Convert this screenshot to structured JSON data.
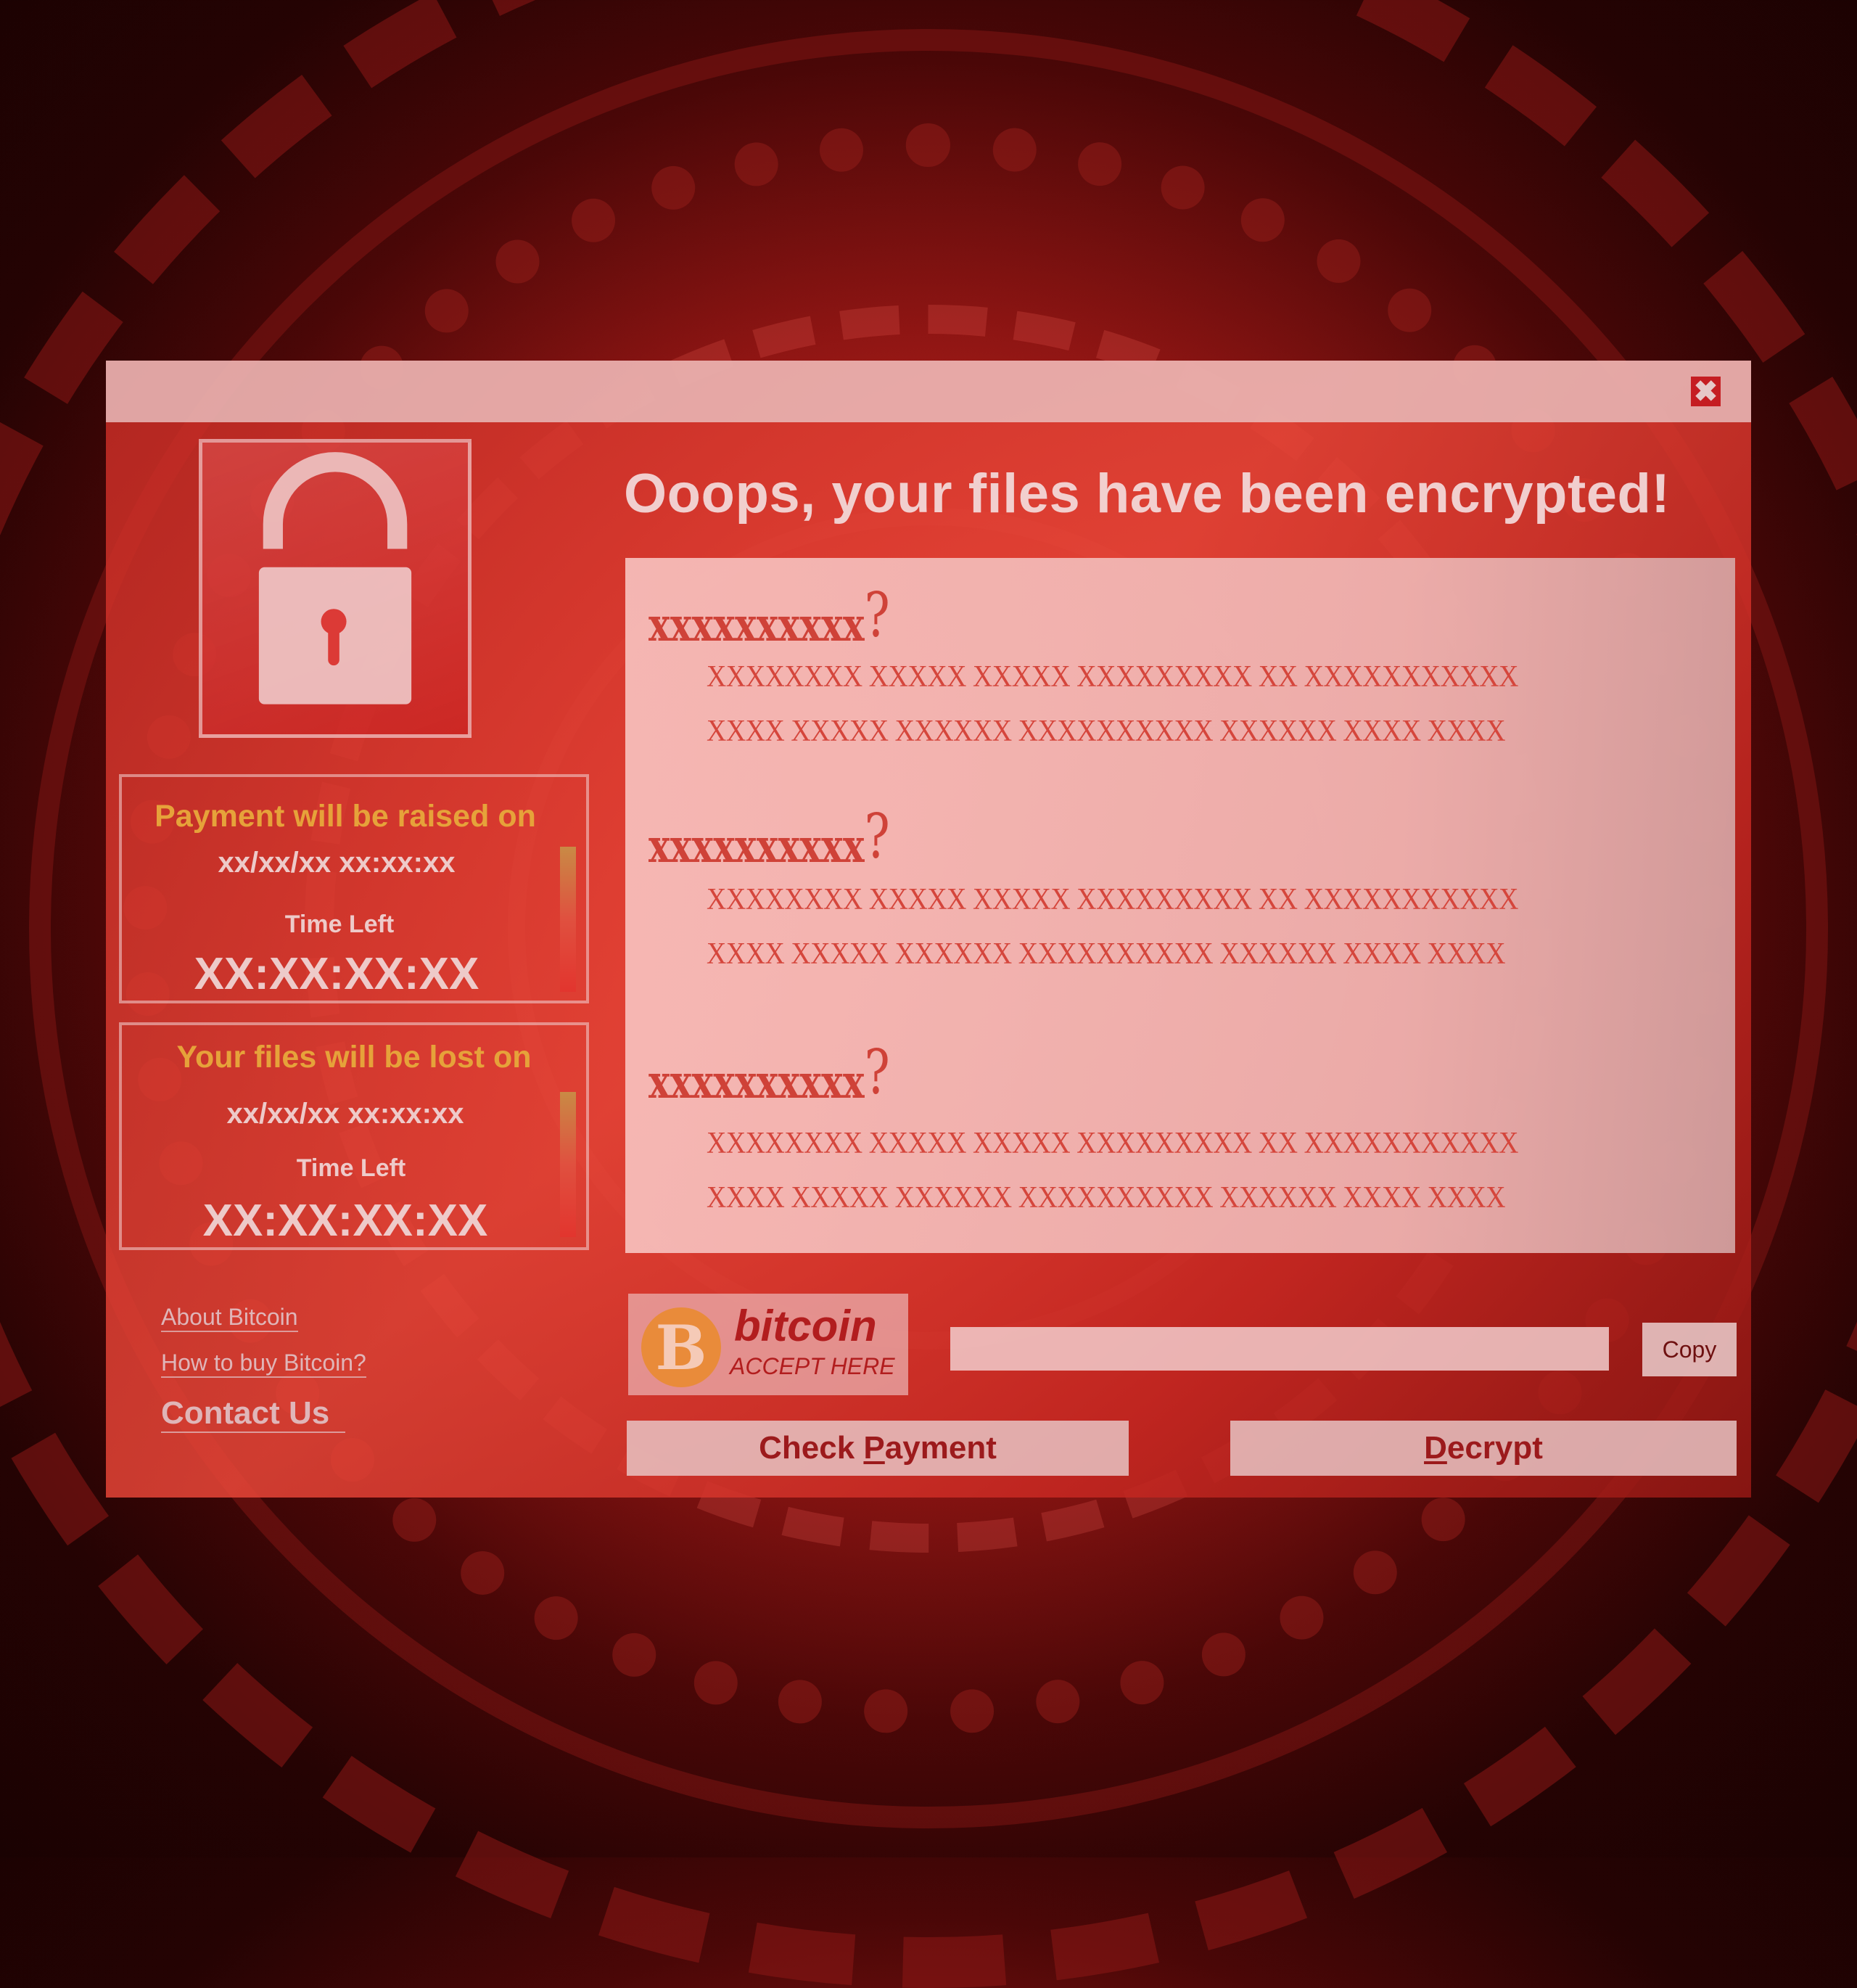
{
  "window": {
    "close_icon": "close-x-icon",
    "headline": "Ooops, your files have been encrypted!"
  },
  "lock": {
    "icon": "padlock-icon"
  },
  "timers": [
    {
      "title": "Payment will be raised on",
      "date": "xx/xx/xx xx:xx:xx",
      "label": "Time Left",
      "countdown": "XX:XX:XX:XX",
      "progress": 1.0
    },
    {
      "title": "Your files will be lost on",
      "date": "xx/xx/xx xx:xx:xx",
      "label": "Time Left",
      "countdown": "XX:XX:XX:XX",
      "progress": 1.0
    }
  ],
  "links": [
    {
      "label": "About Bitcoin"
    },
    {
      "label": "How to buy Bitcoin?"
    },
    {
      "label": "Contact Us"
    }
  ],
  "content": {
    "sections": [
      {
        "heading": "xxxxxxxxxx",
        "heading_suffix": "?",
        "lines": [
          "XXXXXXXX XXXXX XXXXX XXXXXXXXX XX XXXXXXXXXXX",
          "XXXX XXXXX XXXXXX XXXXXXXXXX XXXXXX XXXX XXXX"
        ]
      },
      {
        "heading": "xxxxxxxxxx",
        "heading_suffix": "?",
        "lines": [
          "XXXXXXXX XXXXX XXXXX XXXXXXXXX XX XXXXXXXXXXX",
          "XXXX XXXXX XXXXXX XXXXXXXXXX XXXXXX XXXX XXXX"
        ]
      },
      {
        "heading": "xxxxxxxxxx",
        "heading_suffix": "?",
        "lines": [
          "XXXXXXXX XXXXX XXXXX XXXXXXXXX XX XXXXXXXXXXX",
          "XXXX XXXXX XXXXXX XXXXXXXXXX XXXXXX XXXX XXXX"
        ]
      }
    ]
  },
  "bitcoin": {
    "symbol": "B",
    "word": "bitcoin",
    "tagline": "ACCEPT HERE",
    "address_value": "",
    "address_placeholder": "",
    "copy_label": "Copy"
  },
  "actions": {
    "check_payment_pre": "Check ",
    "check_payment_mnemonic": "P",
    "check_payment_post": "ayment",
    "decrypt_mnemonic": "D",
    "decrypt_post": "ecrypt"
  },
  "colors": {
    "accent_orange": "#e6a23a",
    "bitcoin_orange": "#e98b3a",
    "close_red": "#c51d22",
    "button_text": "#9c1a1c"
  }
}
